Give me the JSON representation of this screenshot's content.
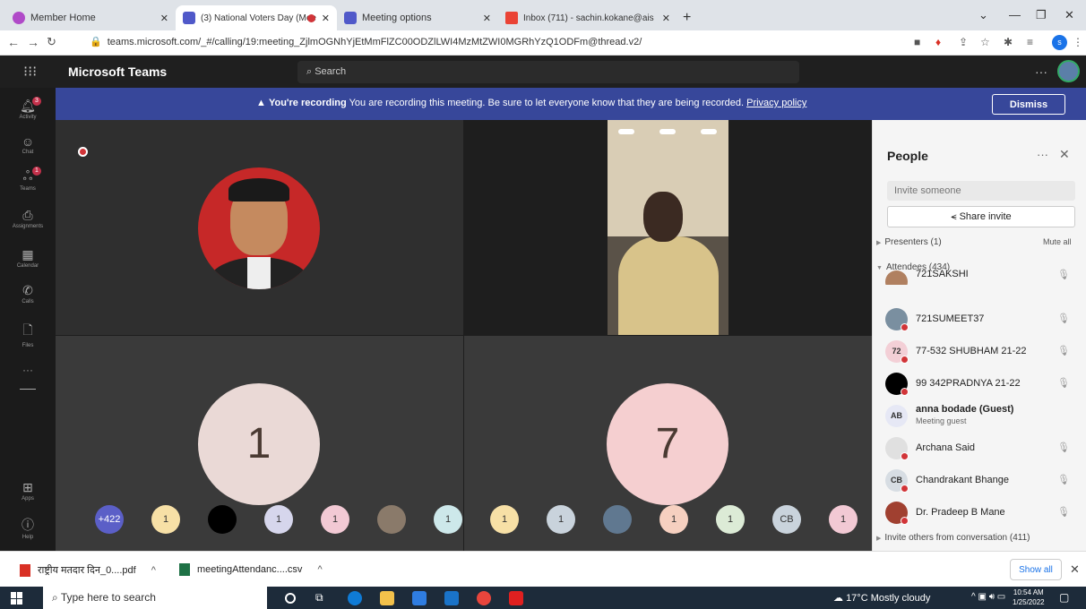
{
  "browser": {
    "tabs": [
      {
        "title": "Member Home",
        "icon_color": "#b04ac8"
      },
      {
        "title": "(3) National Voters Day (Mee",
        "icon_color": "#5059c9",
        "recording": true
      },
      {
        "title": "Meeting options",
        "icon_color": "#5059c9"
      },
      {
        "title": "Inbox (711) - sachin.kokane@ais",
        "icon_color": "#ea4335"
      }
    ],
    "url": "teams.microsoft.com/_#/calling/19:meeting_ZjlmOGNhYjEtMmFlZC00ODZlLWI4MzMtZWI0MGRhYzQ1ODFm@thread.v2/",
    "profile_initial": "s"
  },
  "teams": {
    "app_name": "Microsoft Teams",
    "search_placeholder": "Search",
    "rail": [
      {
        "label": "Activity",
        "icon": "bell-icon",
        "badge": "3"
      },
      {
        "label": "Chat",
        "icon": "chat-icon"
      },
      {
        "label": "Teams",
        "icon": "teams-icon",
        "badge": "1"
      },
      {
        "label": "Assignments",
        "icon": "assignments-icon"
      },
      {
        "label": "Calendar",
        "icon": "calendar-icon"
      },
      {
        "label": "Calls",
        "icon": "phone-icon"
      },
      {
        "label": "Files",
        "icon": "file-icon"
      },
      {
        "label": "Apps",
        "icon": "apps-icon"
      },
      {
        "label": "Help",
        "icon": "help-icon"
      }
    ]
  },
  "banner": {
    "title": "You're recording",
    "message": "You are recording this meeting. Be sure to let everyone know that they are being recorded.",
    "link": "Privacy policy",
    "dismiss": "Dismiss"
  },
  "stage": {
    "tile3_number": "1",
    "tile4_number": "7",
    "strip": [
      {
        "text": "+422",
        "color": "#5b5fc7",
        "fg": "#fff"
      },
      {
        "text": "1",
        "color": "#f7e0a6"
      },
      {
        "text": "",
        "color": "#000"
      },
      {
        "text": "1",
        "color": "#d6d6ec"
      },
      {
        "text": "1",
        "color": "#f2c9d4"
      },
      {
        "text": "",
        "color": "#8a7a6a"
      },
      {
        "text": "1",
        "color": "#cde8ea"
      },
      {
        "text": "1",
        "color": "#f7e0a6"
      },
      {
        "text": "1",
        "color": "#c9d3dc"
      },
      {
        "text": "",
        "color": "#607890"
      },
      {
        "text": "1",
        "color": "#f6d0c0"
      },
      {
        "text": "1",
        "color": "#dcebd6"
      },
      {
        "text": "CB",
        "color": "#c9d3dc"
      },
      {
        "text": "1",
        "color": "#f2c9d4"
      }
    ]
  },
  "people": {
    "title": "People",
    "invite_placeholder": "Invite someone",
    "share_invite": "Share invite",
    "presenters": "Presenters (1)",
    "mute_all": "Mute all",
    "attendees": "Attendees (434)",
    "list": [
      {
        "name": "721SAKSHI",
        "initials": "",
        "color": "#b08060",
        "partial": true
      },
      {
        "name": "721SUMEET37",
        "initials": "",
        "color": "#7a8fa0"
      },
      {
        "name": "77-532 SHUBHAM 21-22",
        "initials": "72",
        "color": "#f3cfd6"
      },
      {
        "name": "99 342PRADNYA 21-22",
        "initials": "",
        "color": "#000000"
      },
      {
        "name": "anna bodade (Guest)",
        "initials": "AB",
        "color": "#e6e8f5",
        "subtitle": "Meeting guest",
        "bold": true
      },
      {
        "name": "Archana Said",
        "initials": "",
        "color": "#e0e0e0"
      },
      {
        "name": "Chandrakant Bhange",
        "initials": "CB",
        "color": "#d7dde3"
      },
      {
        "name": "Dr. Pradeep B Mane",
        "initials": "",
        "color": "#a04030"
      }
    ],
    "invite_others": "Invite others from conversation (411)"
  },
  "downloads": {
    "items": [
      {
        "name": "राष्ट्रीय मतदार दिन_0....pdf",
        "color": "#d93025"
      },
      {
        "name": "meetingAttendanc....csv",
        "color": "#1e7145"
      }
    ],
    "show_all": "Show all"
  },
  "taskbar": {
    "search_placeholder": "Type here to search",
    "weather": "17°C  Mostly cloudy",
    "time": "10:54 AM",
    "date": "1/25/2022"
  }
}
